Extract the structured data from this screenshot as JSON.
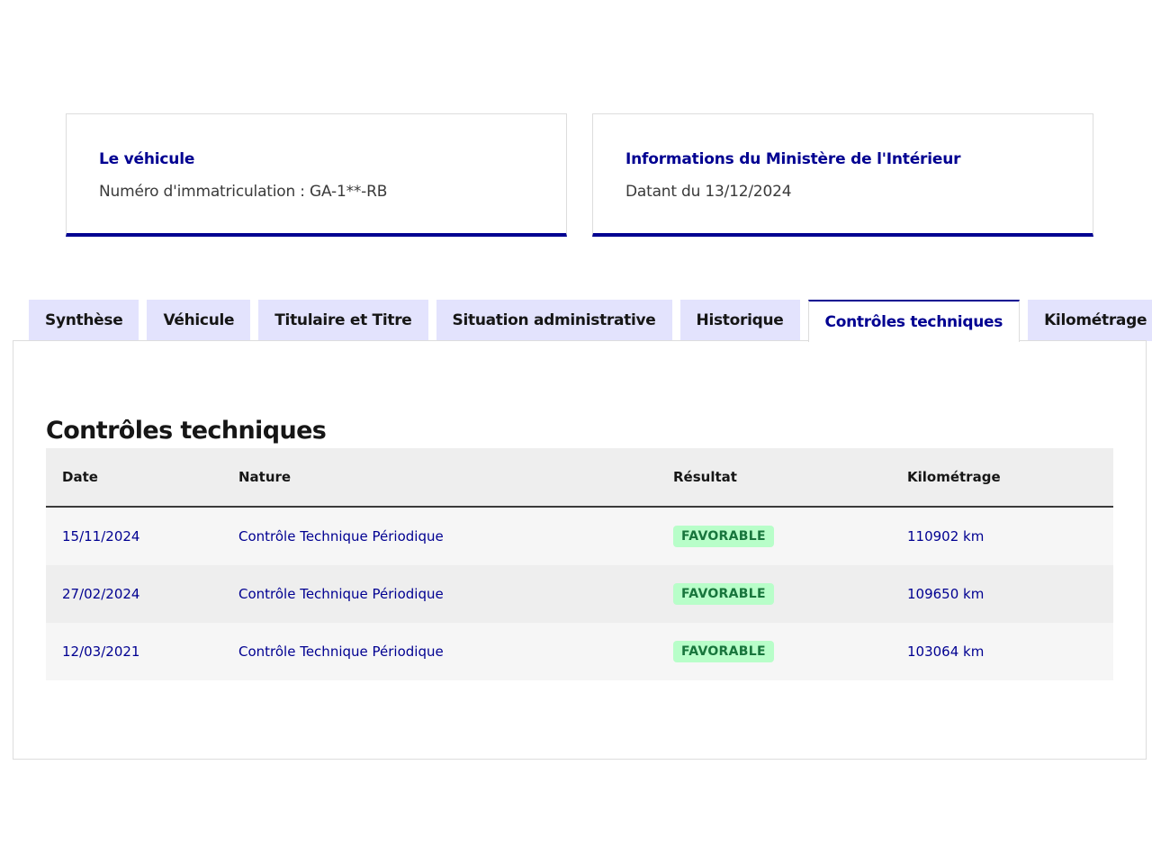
{
  "cards": {
    "vehicle": {
      "title": "Le véhicule",
      "text": "Numéro d'immatriculation : GA-1**-RB"
    },
    "ministry": {
      "title": "Informations du Ministère de l'Intérieur",
      "text": "Datant du 13/12/2024"
    }
  },
  "tabs": [
    {
      "label": "Synthèse"
    },
    {
      "label": "Véhicule"
    },
    {
      "label": "Titulaire et Titre"
    },
    {
      "label": "Situation administrative"
    },
    {
      "label": "Historique"
    },
    {
      "label": "Contrôles techniques",
      "active": true
    },
    {
      "label": "Kilométrage"
    }
  ],
  "section": {
    "title": "Contrôles techniques"
  },
  "table": {
    "headers": {
      "date": "Date",
      "nature": "Nature",
      "result": "Résultat",
      "km": "Kilométrage"
    },
    "rows": [
      {
        "date": "15/11/2024",
        "nature": "Contrôle Technique Périodique",
        "result": "FAVORABLE",
        "km": "110902 km"
      },
      {
        "date": "27/02/2024",
        "nature": "Contrôle Technique Périodique",
        "result": "FAVORABLE",
        "km": "109650 km"
      },
      {
        "date": "12/03/2021",
        "nature": "Contrôle Technique Périodique",
        "result": "FAVORABLE",
        "km": "103064 km"
      }
    ]
  },
  "colors": {
    "accent": "#000091",
    "tab_bg": "#e3e3fd",
    "badge_bg": "#b8fec9",
    "badge_text": "#18753c"
  }
}
